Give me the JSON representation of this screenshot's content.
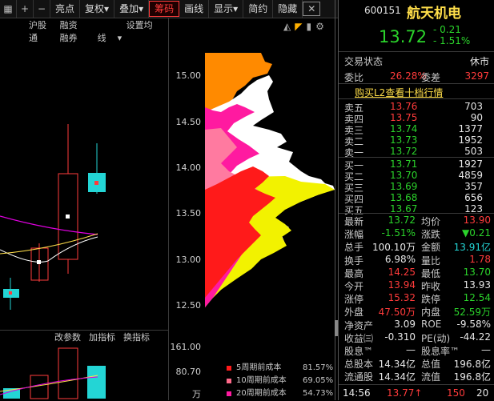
{
  "toolbar": {
    "items": [
      "亮点",
      "复权",
      "叠加",
      "筹码",
      "画线",
      "显示",
      "简约",
      "隐藏"
    ],
    "icons": [
      "grid-icon",
      "plus-icon",
      "minus-icon",
      "close-icon"
    ]
  },
  "subbar": [
    "沪股通",
    "融资融券",
    "设置均线"
  ],
  "midbar": [
    "改参数",
    "加指标",
    "换指标"
  ],
  "axis": [
    "15.00",
    "14.50",
    "14.00",
    "13.50",
    "13.00",
    "12.50",
    "161.00",
    "80.70",
    "万"
  ],
  "legend": [
    {
      "label": "5周期前成本",
      "pct": "81.57%",
      "color": "#ff1a1a"
    },
    {
      "label": "10周期前成本",
      "pct": "69.05%",
      "color": "#ff6a8a"
    },
    {
      "label": "20周期前成本",
      "pct": "54.73%",
      "color": "#ff1aa0"
    }
  ],
  "quote": {
    "code": "600151",
    "name": "航天机电",
    "price": "13.72",
    "change": "- 0.21",
    "change_pct": "- 1.51%",
    "status_label": "交易状态",
    "status": "休市",
    "weibi_label": "委比",
    "weibi": "26.28%",
    "weicha_label": "委差",
    "weicha": "3297",
    "l2_link": "购买L2查看十档行情"
  },
  "asks": [
    {
      "label": "卖五",
      "price": "13.76",
      "vol": "703"
    },
    {
      "label": "卖四",
      "price": "13.75",
      "vol": "90"
    },
    {
      "label": "卖三",
      "price": "13.74",
      "vol": "1377"
    },
    {
      "label": "卖二",
      "price": "13.73",
      "vol": "1952"
    },
    {
      "label": "卖一",
      "price": "13.72",
      "vol": "503"
    }
  ],
  "bids": [
    {
      "label": "买一",
      "price": "13.71",
      "vol": "1927"
    },
    {
      "label": "买二",
      "price": "13.70",
      "vol": "4859"
    },
    {
      "label": "买三",
      "price": "13.69",
      "vol": "357"
    },
    {
      "label": "买四",
      "price": "13.68",
      "vol": "656"
    },
    {
      "label": "买五",
      "price": "13.67",
      "vol": "123"
    }
  ],
  "stats": [
    {
      "k1": "最新",
      "v1": "13.72",
      "c1": "green",
      "k2": "均价",
      "v2": "13.90",
      "c2": "red"
    },
    {
      "k1": "涨幅",
      "v1": "-1.51%",
      "c1": "green",
      "k2": "涨跌",
      "v2": "▼0.21",
      "c2": "green"
    },
    {
      "k1": "总手",
      "v1": "100.10万",
      "c1": "white",
      "k2": "金额",
      "v2": "13.91亿",
      "c2": "cyan"
    },
    {
      "k1": "换手",
      "v1": "6.98%",
      "c1": "white",
      "k2": "量比",
      "v2": "1.78",
      "c2": "red"
    },
    {
      "k1": "最高",
      "v1": "14.25",
      "c1": "red",
      "k2": "最低",
      "v2": "13.70",
      "c2": "green"
    },
    {
      "k1": "今开",
      "v1": "13.94",
      "c1": "red",
      "k2": "昨收",
      "v2": "13.93",
      "c2": "white"
    },
    {
      "k1": "涨停",
      "v1": "15.32",
      "c1": "red",
      "k2": "跌停",
      "v2": "12.54",
      "c2": "green"
    },
    {
      "k1": "外盘",
      "v1": "47.50万",
      "c1": "red",
      "k2": "内盘",
      "v2": "52.59万",
      "c2": "green"
    },
    {
      "k1": "净资产",
      "v1": "3.09",
      "c1": "white",
      "k2": "ROE",
      "v2": "-9.58%",
      "c2": "white"
    },
    {
      "k1": "收益㈢",
      "v1": "-0.310",
      "c1": "white",
      "k2": "PE(动)",
      "v2": "-44.22",
      "c2": "white"
    },
    {
      "k1": "股息™",
      "v1": "—",
      "c1": "white",
      "k2": "股息率™",
      "v2": "—",
      "c2": "white"
    },
    {
      "k1": "总股本",
      "v1": "14.34亿",
      "c1": "white",
      "k2": "总值",
      "v2": "196.8亿",
      "c2": "white"
    },
    {
      "k1": "流通股",
      "v1": "14.34亿",
      "c1": "white",
      "k2": "流值",
      "v2": "196.8亿",
      "c2": "white"
    }
  ],
  "tick": {
    "time": "14:56",
    "price": "13.77↑",
    "vol": "150",
    "num": "20"
  }
}
